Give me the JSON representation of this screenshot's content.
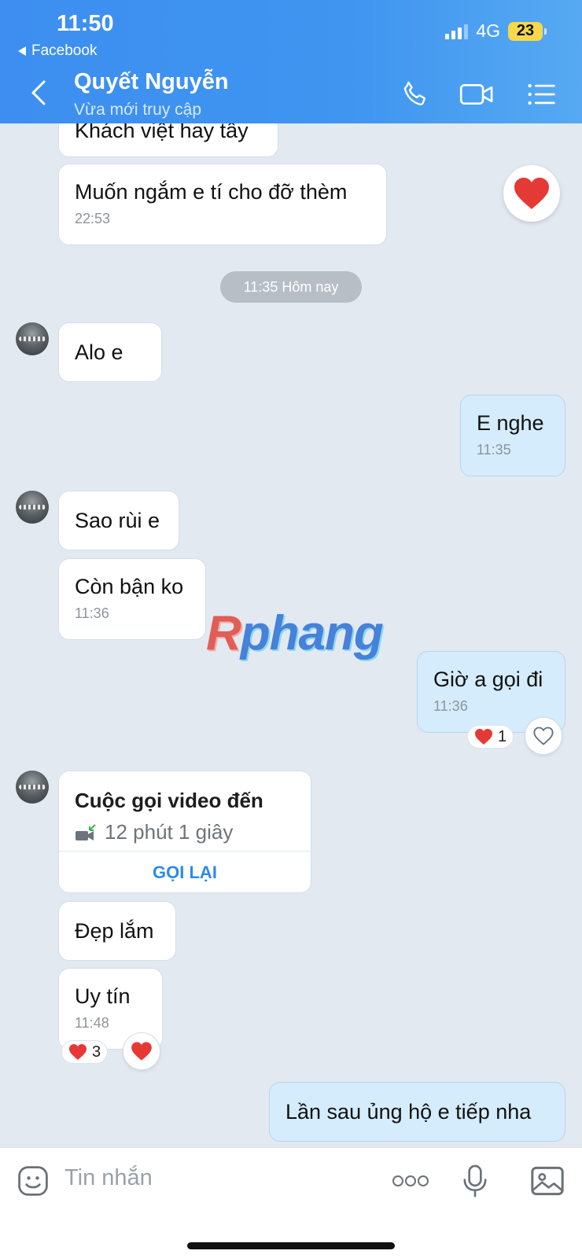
{
  "status_bar": {
    "time": "11:50",
    "back_app": "Facebook",
    "network": "4G",
    "battery": "23"
  },
  "header": {
    "contact_name": "Quyết Nguyễn",
    "contact_status": "Vừa mới truy cập",
    "icons": [
      "back-icon",
      "phone-icon",
      "video-call-icon",
      "menu-list-icon"
    ]
  },
  "messages": {
    "m0": {
      "text": "Khách việt hay tây"
    },
    "m1": {
      "text": "Muốn ngắm e tí cho đỡ thèm",
      "time": "22:53"
    },
    "divider": "11:35 Hôm nay",
    "m2": {
      "text": "Alo e"
    },
    "m3": {
      "text": "E nghe",
      "time": "11:35"
    },
    "m4": {
      "text": "Sao rùi e"
    },
    "m5": {
      "text": "Còn bận ko",
      "time": "11:36"
    },
    "m6": {
      "text": "Giờ a gọi đi",
      "time": "11:36",
      "reaction_count": "1"
    },
    "call": {
      "title": "Cuộc gọi video đến",
      "duration": "12 phút 1 giây",
      "action": "GỌI LẠI"
    },
    "m7": {
      "text": "Đẹp lắm"
    },
    "m8": {
      "text": "Uy tín",
      "time": "11:48",
      "reaction_count": "3"
    },
    "m9": {
      "text": "Lần sau ủng hộ e tiếp nha"
    }
  },
  "watermark": {
    "text": "Rphang",
    "first": "R",
    "rest": "phang"
  },
  "input": {
    "placeholder": "Tin nhắn",
    "icons": [
      "sticker-icon",
      "more-icon",
      "microphone-icon",
      "image-icon"
    ]
  },
  "colors": {
    "header": "#3d8ef0",
    "background": "#e2e9f1",
    "my_bubble": "#d4ecfb",
    "accent": "#2c8be6",
    "heart": "#e53935"
  }
}
